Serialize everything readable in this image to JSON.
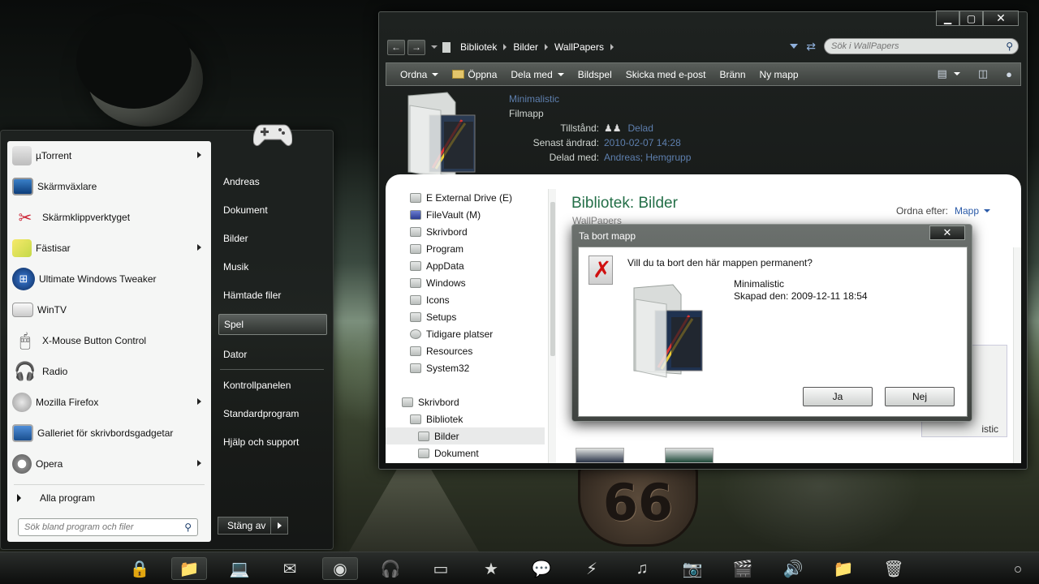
{
  "start_menu": {
    "programs": [
      {
        "label": "µTorrent",
        "icon": "utorrent-icon",
        "has_submenu": true
      },
      {
        "label": "Skärmväxlare",
        "icon": "monitor-icon",
        "has_submenu": false
      },
      {
        "label": "Skärmklippverktyget",
        "icon": "scissors-icon",
        "has_submenu": false
      },
      {
        "label": "Fästisar",
        "icon": "sticky-notes-icon",
        "has_submenu": true
      },
      {
        "label": "Ultimate Windows Tweaker",
        "icon": "windows-logo-icon",
        "has_submenu": false
      },
      {
        "label": "WinTV",
        "icon": "tv-icon",
        "has_submenu": false
      },
      {
        "label": "X-Mouse Button Control",
        "icon": "mouse-icon",
        "has_submenu": false
      },
      {
        "label": "Radio",
        "icon": "headphones-icon",
        "has_submenu": false
      },
      {
        "label": "Mozilla Firefox",
        "icon": "firefox-icon",
        "has_submenu": true
      },
      {
        "label": "Galleriet för skrivbordsgadgetar",
        "icon": "gadget-gallery-icon",
        "has_submenu": false
      },
      {
        "label": "Opera",
        "icon": "opera-icon",
        "has_submenu": true
      }
    ],
    "all_programs": "Alla program",
    "search_placeholder": "Sök bland program och filer",
    "right_items": [
      {
        "label": "Andreas"
      },
      {
        "label": "Dokument"
      },
      {
        "label": "Bilder"
      },
      {
        "label": "Musik"
      },
      {
        "label": "Hämtade filer"
      },
      {
        "label": "Spel",
        "active": true
      },
      {
        "label": "Dator"
      },
      {
        "label": "Kontrollpanelen"
      },
      {
        "label": "Standardprogram"
      },
      {
        "label": "Hjälp och support"
      }
    ],
    "shutdown_label": "Stäng av"
  },
  "explorer": {
    "controls": {
      "minimize": "▁",
      "maximize": "▢",
      "close": "✕"
    },
    "breadcrumb": [
      "Bibliotek",
      "Bilder",
      "WallPapers"
    ],
    "search_placeholder": "Sök i WallPapers",
    "toolbar": [
      {
        "label": "Ordna",
        "dropdown": true
      },
      {
        "label": "Öppna",
        "dropdown": false,
        "icon": "folder-icon"
      },
      {
        "label": "Dela med",
        "dropdown": true
      },
      {
        "label": "Bildspel",
        "dropdown": false
      },
      {
        "label": "Skicka med e-post",
        "dropdown": false
      },
      {
        "label": "Bränn",
        "dropdown": false
      },
      {
        "label": "Ny mapp",
        "dropdown": false
      }
    ],
    "details": {
      "name": "Minimalistic",
      "type": "Filmapp",
      "rows": [
        {
          "label": "Tillstånd:",
          "value": "Delad",
          "icon": "users-icon"
        },
        {
          "label": "Senast ändrad:",
          "value": "2010-02-07 14:28"
        },
        {
          "label": "Delad med:",
          "value": "Andreas; Hemgrupp"
        }
      ]
    },
    "nav_tree": [
      {
        "label": "E External Drive (E)",
        "icon": "drive-icon"
      },
      {
        "label": "FileVault (M)",
        "icon": "drive-icon"
      },
      {
        "label": "Skrivbord",
        "icon": "desktop-icon"
      },
      {
        "label": "Program",
        "icon": "folder-icon"
      },
      {
        "label": "AppData",
        "icon": "folder-icon"
      },
      {
        "label": "Windows",
        "icon": "folder-icon"
      },
      {
        "label": "Icons",
        "icon": "folder-icon"
      },
      {
        "label": "Setups",
        "icon": "folder-icon"
      },
      {
        "label": "Tidigare platser",
        "icon": "recent-places-icon"
      },
      {
        "label": "Resources",
        "icon": "folder-icon"
      },
      {
        "label": "System32",
        "icon": "folder-icon"
      },
      {
        "label": "Skrivbord",
        "icon": "desktop-icon"
      },
      {
        "label": "Bibliotek",
        "icon": "library-icon"
      },
      {
        "label": "Bilder",
        "icon": "pictures-icon",
        "selected": true
      },
      {
        "label": "Dokument",
        "icon": "documents-icon"
      }
    ],
    "library_title": "Bibliotek: Bilder",
    "library_subtitle": "WallPapers",
    "arrange_label": "Ordna efter:",
    "arrange_value": "Mapp",
    "partial_label": "istic"
  },
  "dialog": {
    "title": "Ta bort mapp",
    "close": "✕",
    "question": "Vill du ta bort den här mappen permanent?",
    "folder_name": "Minimalistic",
    "created": "Skapad den: 2009-12-11 18:54",
    "yes_label": "Ja",
    "no_label": "Nej"
  },
  "taskbar": {
    "icons": [
      "lock-icon",
      "folder-icon",
      "computer-icon",
      "mail-icon",
      "firefox-icon",
      "headphones-icon",
      "window-icon",
      "star-icon",
      "chat-icon",
      "lightning-icon",
      "music-icon",
      "camera-icon",
      "clapperboard-icon",
      "speaker-icon",
      "folder-icon",
      "recycle-bin-icon"
    ]
  }
}
